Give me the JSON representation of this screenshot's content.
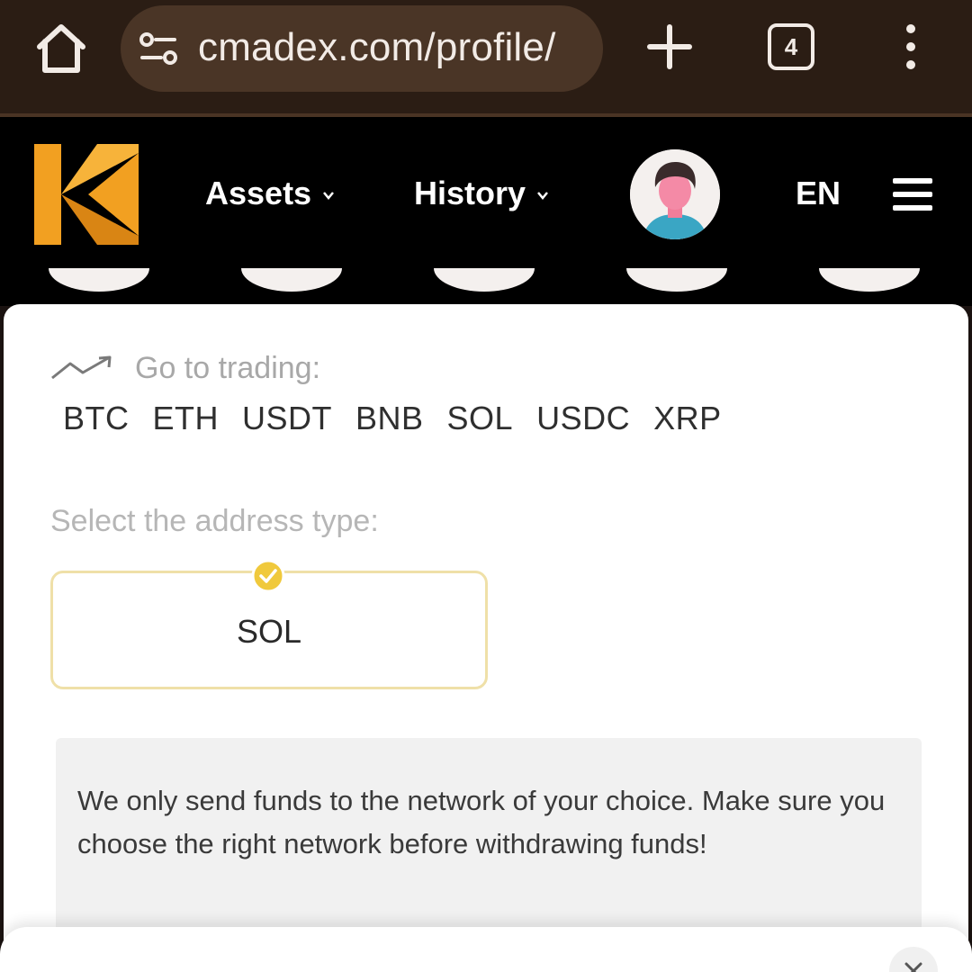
{
  "browser": {
    "url": "cmadex.com/profile/",
    "tab_count": "4",
    "icons": [
      "home-icon",
      "tune-icon",
      "plus-icon",
      "tabs-icon",
      "more-vert-icon"
    ]
  },
  "header": {
    "nav": [
      {
        "label": "Assets"
      },
      {
        "label": "History"
      }
    ],
    "language": "EN",
    "icons": [
      "logo-icon",
      "avatar",
      "hamburger-menu-icon"
    ]
  },
  "trading": {
    "label": "Go to trading:",
    "coins": [
      "BTC",
      "ETH",
      "USDT",
      "BNB",
      "SOL",
      "USDC",
      "XRP"
    ]
  },
  "address_type": {
    "label": "Select the address type:",
    "selected": "SOL"
  },
  "notice": {
    "text": "We only send funds to the network of your choice. Make sure you choose the right network before withdrawing funds!"
  },
  "colors": {
    "browser_bar": "#2b1d14",
    "url_pill": "#4a3526",
    "header_bg": "#000000",
    "logo_orange": "#f2a021",
    "accent_yellow": "#f0c93c",
    "card_bg": "#ffffff",
    "notice_bg": "#f1f1f1"
  }
}
